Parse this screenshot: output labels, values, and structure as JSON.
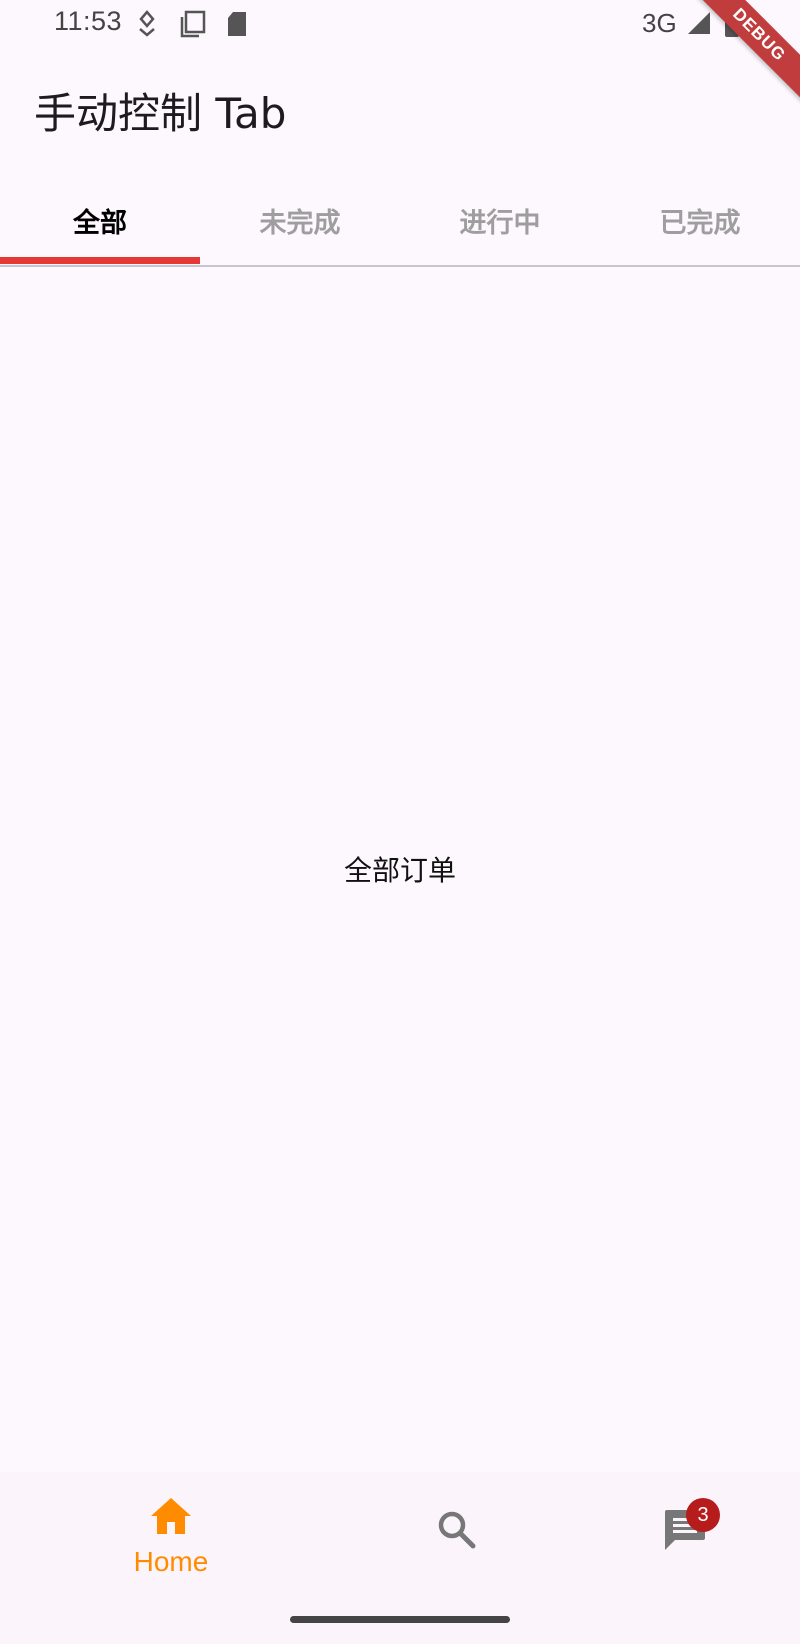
{
  "status_bar": {
    "time": "11:53",
    "network": "3G",
    "icons": [
      "location-icon",
      "screenshot-icon",
      "sd-card-icon",
      "signal-icon",
      "battery-icon"
    ]
  },
  "debug_banner": "DEBUG",
  "app_bar": {
    "title": "手动控制 Tab"
  },
  "tabs": [
    {
      "label": "全部",
      "active": true
    },
    {
      "label": "未完成",
      "active": false
    },
    {
      "label": "进行中",
      "active": false
    },
    {
      "label": "已完成",
      "active": false
    }
  ],
  "content": {
    "text": "全部订单"
  },
  "bottom_nav": {
    "items": [
      {
        "icon": "home-icon",
        "label": "Home",
        "selected": true
      },
      {
        "icon": "search-icon",
        "label": "",
        "selected": false
      },
      {
        "icon": "message-icon",
        "label": "",
        "selected": false,
        "badge": "3"
      }
    ]
  },
  "colors": {
    "tab_indicator": "#e53935",
    "selected_nav": "#ff8c00",
    "badge": "#b71c1c",
    "inactive_tab": "#9e9e9e"
  }
}
